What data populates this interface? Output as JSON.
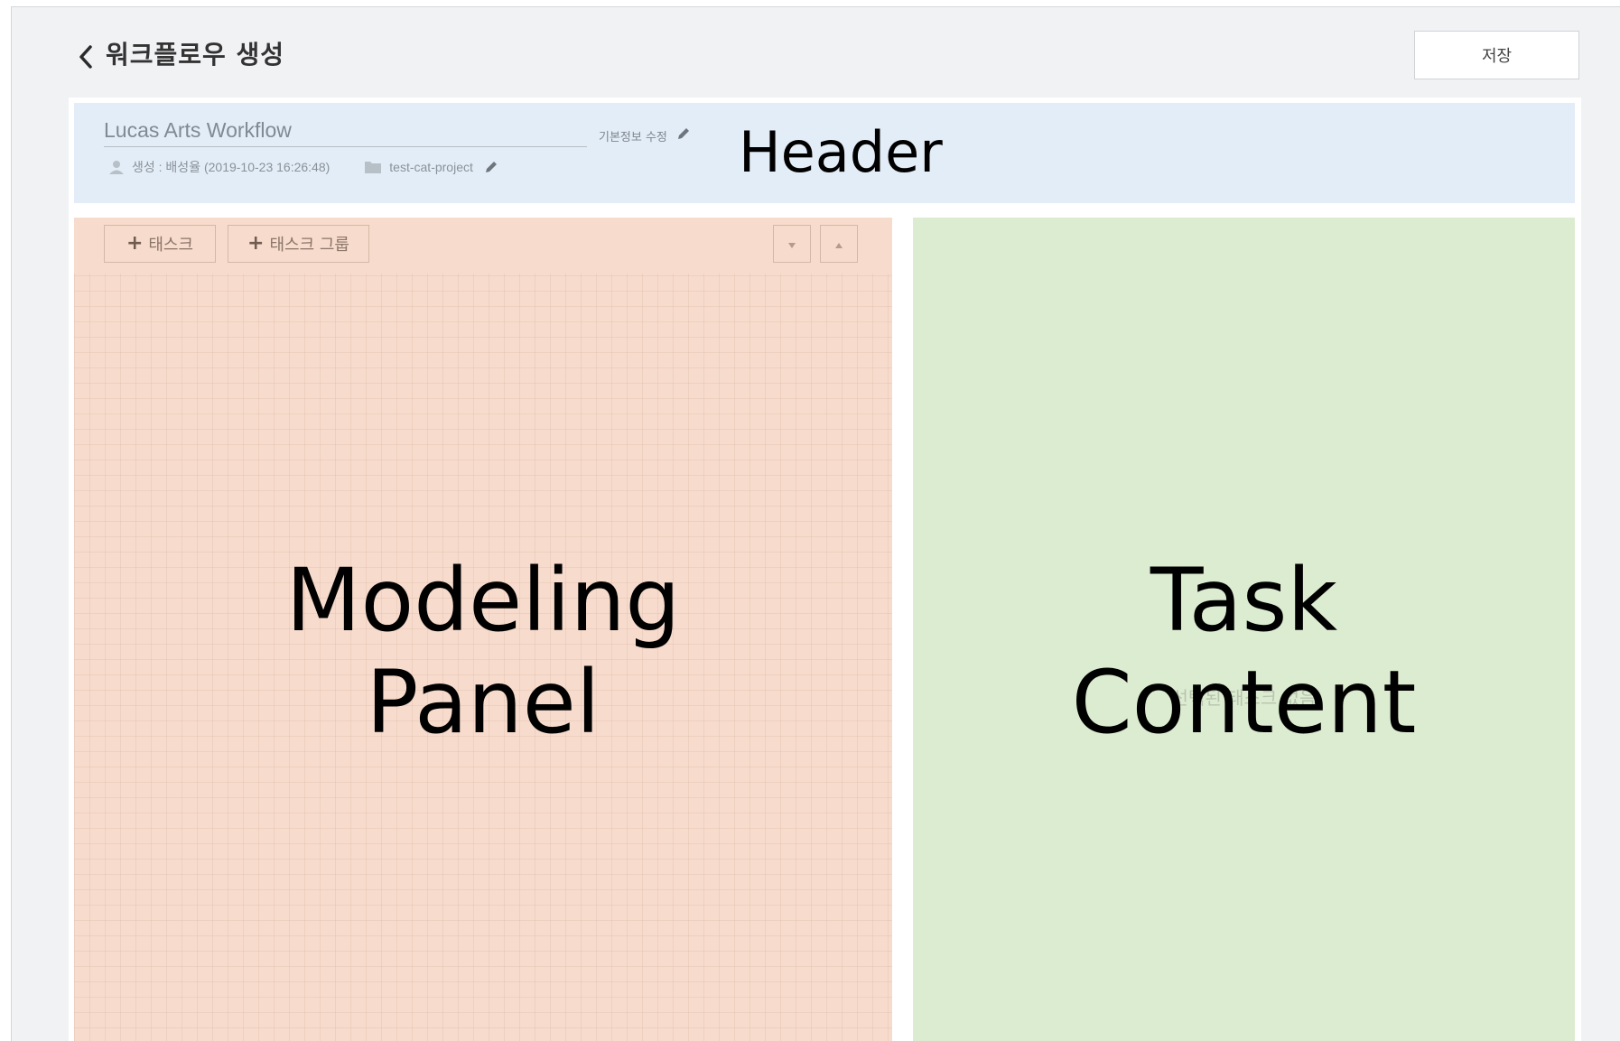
{
  "page": {
    "title": "워크플로우 생성",
    "save_label": "저장"
  },
  "header": {
    "workflow_name": "Lucas Arts Workflow",
    "edit_info_label": "기본정보 수정",
    "created_text": "생성 : 배성율 (2019-10-23 16:26:48)",
    "project": "test-cat-project",
    "overlay_label": "Header"
  },
  "modeling_panel": {
    "add_task_label": "태스크",
    "add_task_group_label": "태스크 그룹",
    "overlay_label_line1": "Modeling",
    "overlay_label_line2": "Panel"
  },
  "task_content": {
    "empty_text": "선택된 태스크 없음",
    "overlay_label_line1": "Task",
    "overlay_label_line2": "Content"
  },
  "colors": {
    "header_region": "#e3edf7",
    "modeling_region": "#f7dbcc",
    "task_region": "#dcecd1"
  },
  "icons": [
    "chevron-left-icon",
    "pencil-icon",
    "user-icon",
    "folder-icon",
    "plus-icon",
    "caret-down-icon",
    "caret-up-icon"
  ]
}
